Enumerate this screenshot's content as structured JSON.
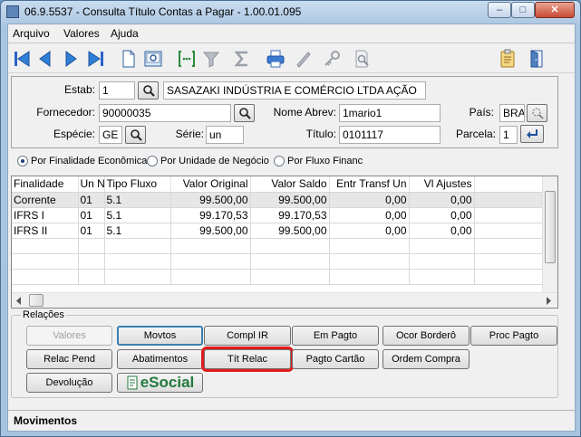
{
  "window": {
    "title": "06.9.5537 - Consulta Título Contas a Pagar - 1.00.01.095",
    "min": "–",
    "max": "□",
    "close": "✕"
  },
  "menu": [
    "Arquivo",
    "Valores",
    "Ajuda"
  ],
  "toolbar": {
    "icons": [
      "first-icon",
      "previous-icon",
      "next-icon",
      "last-icon",
      "new-document-icon",
      "preview-icon",
      "select-icon",
      "filter-icon",
      "sum-icon",
      "print-icon",
      "edit-pencil-icon",
      "key-icon",
      "search-document-icon",
      "clipboard-icon",
      "exit-door-icon"
    ]
  },
  "form": {
    "estab_label": "Estab:",
    "estab_value": "1",
    "estab_name": "SASAZAKI INDÚSTRIA E COMÉRCIO LTDA AÇÃO",
    "fornecedor_label": "Fornecedor:",
    "fornecedor_value": "90000035",
    "nome_abrev_label": "Nome Abrev:",
    "nome_abrev_value": "1mario1",
    "pais_label": "País:",
    "pais_value": "BRA",
    "especie_label": "Espécie:",
    "especie_value": "GE",
    "serie_label": "Série:",
    "serie_value": "un",
    "titulo_label": "Título:",
    "titulo_value": "0101117",
    "parcela_label": "Parcela:",
    "parcela_value": "1"
  },
  "radios": [
    {
      "label": "Por Finalidade Econômica",
      "selected": true
    },
    {
      "label": "Por Unidade de Negócio",
      "selected": false
    },
    {
      "label": "Por Fluxo Financ",
      "selected": false
    }
  ],
  "table": {
    "columns": [
      "Finalidade",
      "Un N",
      "Tipo Fluxo",
      "Valor Original",
      "Valor Saldo",
      "Entr Transf Un",
      "Vl Ajustes"
    ],
    "rows": [
      [
        "Corrente",
        "01",
        "5.1",
        "99.500,00",
        "99.500,00",
        "0,00",
        "0,00"
      ],
      [
        "IFRS I",
        "01",
        "5.1",
        "99.170,53",
        "99.170,53",
        "0,00",
        "0,00"
      ],
      [
        "IFRS II",
        "01",
        "5.1",
        "99.500,00",
        "99.500,00",
        "0,00",
        "0,00"
      ]
    ]
  },
  "relacoes": {
    "title": "Relações",
    "buttons": {
      "valores": "Valores",
      "movtos": "Movtos",
      "compl_ir": "Compl IR",
      "em_pagto": "Em Pagto",
      "ocor_bordero": "Ocor Borderô",
      "proc_pagto": "Proc Pagto",
      "relac_pend": "Relac Pend",
      "abatimentos": "Abatimentos",
      "tit_relac": "Tít  Relac",
      "pagto_cartao": "Pagto Cartão",
      "ordem_compra": "Ordem Compra",
      "devolucao": "Devolução"
    },
    "esocial_logo": "eSocial"
  },
  "status": "Movimentos",
  "colors": {
    "accent": "#2f7fd6",
    "highlight": "#e01b1b",
    "esocial": "#217a3c"
  }
}
